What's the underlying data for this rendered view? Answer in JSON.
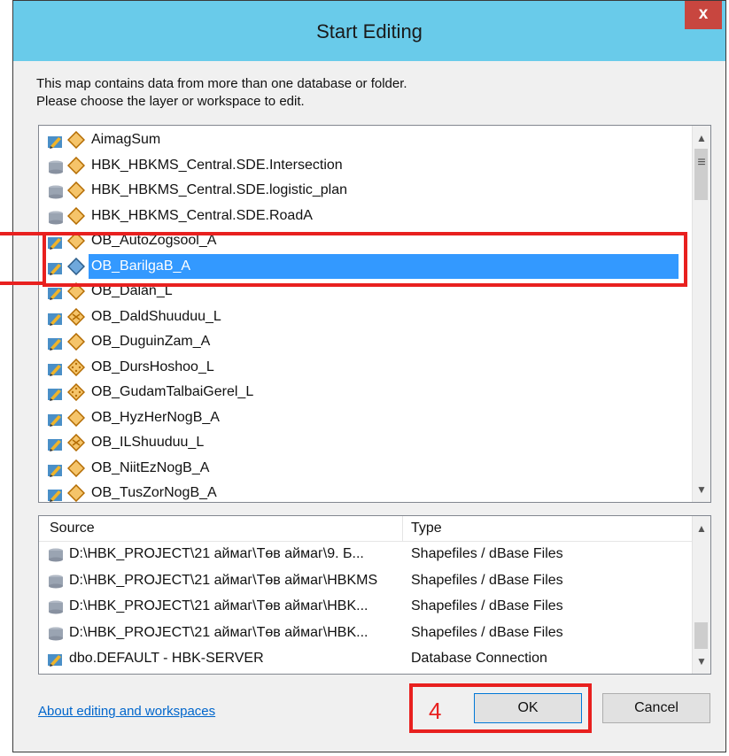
{
  "window": {
    "title": "Start Editing",
    "close_label": "x"
  },
  "instruction": {
    "line1": "This map contains data from more than one database or folder.",
    "line2": "Please choose the layer or workspace to edit."
  },
  "layers": [
    {
      "label": "AimagSum",
      "source": "pencil",
      "sym": "diamond-orange"
    },
    {
      "label": "HBK_HBKMS_Central.SDE.Intersection",
      "source": "db",
      "sym": "diamond-orange"
    },
    {
      "label": "HBK_HBKMS_Central.SDE.logistic_plan",
      "source": "db",
      "sym": "diamond-orange"
    },
    {
      "label": "HBK_HBKMS_Central.SDE.RoadA",
      "source": "db",
      "sym": "diamond-orange"
    },
    {
      "label": "OB_AutoZogsool_A",
      "source": "pencil",
      "sym": "diamond-orange"
    },
    {
      "label": "OB_BarilgaB_A",
      "source": "pencil",
      "sym": "diamond-blue",
      "selected": true
    },
    {
      "label": "OB_Dalan_L",
      "source": "pencil",
      "sym": "diamond-orange"
    },
    {
      "label": "OB_DaldShuuduu_L",
      "source": "pencil",
      "sym": "diamond-x"
    },
    {
      "label": "OB_DuguinZam_A",
      "source": "pencil",
      "sym": "diamond-orange"
    },
    {
      "label": "OB_DursHoshoo_L",
      "source": "pencil",
      "sym": "diamond-dots"
    },
    {
      "label": "OB_GudamTalbaiGerel_L",
      "source": "pencil",
      "sym": "diamond-dots"
    },
    {
      "label": "OB_HyzHerNogB_A",
      "source": "pencil",
      "sym": "diamond-orange"
    },
    {
      "label": "OB_ILShuuduu_L",
      "source": "pencil",
      "sym": "diamond-x"
    },
    {
      "label": "OB_NiitEzNogB_A",
      "source": "pencil",
      "sym": "diamond-orange"
    },
    {
      "label": "OB_TusZorNogB_A",
      "source": "pencil",
      "sym": "diamond-orange"
    }
  ],
  "sources": {
    "header_source": "Source",
    "header_type": "Type",
    "rows": [
      {
        "source": "D:\\HBK_PROJECT\\21 аймаг\\Төв аймаг\\9. Б...",
        "type": "Shapefiles / dBase Files",
        "icon": "db"
      },
      {
        "source": "D:\\HBK_PROJECT\\21 аймаг\\Төв аймаг\\HBKMS",
        "type": "Shapefiles / dBase Files",
        "icon": "db"
      },
      {
        "source": "D:\\HBK_PROJECT\\21 аймаг\\Төв аймаг\\HBK...",
        "type": "Shapefiles / dBase Files",
        "icon": "db"
      },
      {
        "source": "D:\\HBK_PROJECT\\21 аймаг\\Төв аймаг\\HBK...",
        "type": "Shapefiles / dBase Files",
        "icon": "db"
      },
      {
        "source": "dbo.DEFAULT - HBK-SERVER",
        "type": "Database Connection",
        "icon": "pencil"
      }
    ]
  },
  "footer": {
    "link": "About editing and workspaces",
    "ok": "OK",
    "cancel": "Cancel",
    "annotation_number": "4"
  },
  "colors": {
    "titlebar": "#69cbea",
    "close": "#c8463f",
    "selection": "#3399ff",
    "annotation": "#e8201f"
  }
}
